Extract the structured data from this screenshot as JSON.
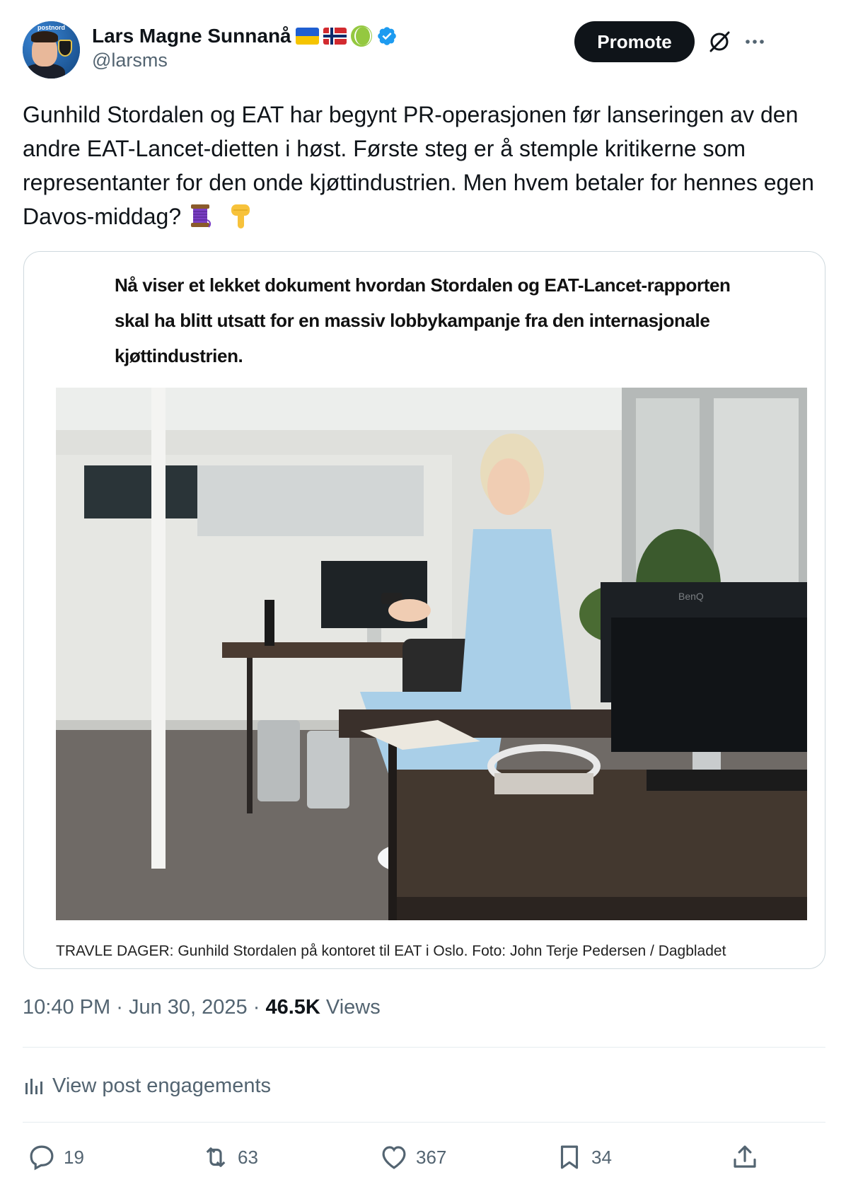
{
  "author": {
    "display_name": "Lars Magne Sunnanå",
    "handle": "@larsms",
    "avatar_text": "postnord",
    "badges": [
      "flag-ukraine-icon",
      "flag-norway-icon",
      "tennis-ball-icon",
      "verified-icon"
    ]
  },
  "header_actions": {
    "promote_label": "Promote",
    "grok_icon": "grok-icon",
    "more_icon": "more-icon"
  },
  "tweet": {
    "text": "Gunhild Stordalen og EAT har begynt PR-operasjonen før lanseringen av den andre EAT-Lancet-dietten i høst. Første steg er å stemple kritikerne som representanter for den onde kjøttindustrien. Men hvem betaler for hennes egen Davos-middag?",
    "emojis": [
      "thread-icon",
      "pointing-down-icon"
    ]
  },
  "media": {
    "quote_text": "Nå viser et lekket dokument hvordan Stordalen og EAT-Lancet-rapporten skal ha blitt utsatt for en massiv lobbykampanje fra den internasjonale kjøttindustrien.",
    "caption": "TRAVLE DAGER: Gunhild Stordalen på kontoret til EAT i Oslo. Foto: John Terje Pedersen / Dagbladet",
    "monitor_brand": "BenQ"
  },
  "meta": {
    "time": "10:40 PM",
    "separator": "·",
    "date": "Jun 30, 2025",
    "views_count": "46.5K",
    "views_label": "Views"
  },
  "engagements": {
    "label": "View post engagements"
  },
  "actions": {
    "replies": "19",
    "reposts": "63",
    "likes": "367",
    "bookmarks": "34"
  },
  "colors": {
    "accent": "#1d9bf0",
    "text_primary": "#0f1419",
    "text_secondary": "#536471",
    "border": "#cfd9de",
    "promote_bg": "#0f1419"
  }
}
